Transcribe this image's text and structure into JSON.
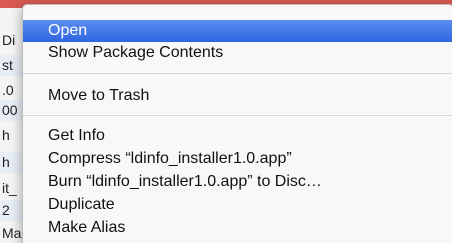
{
  "background_window": {
    "title_bar_color": "#d85a52",
    "rows": [
      "Di",
      "st",
      ".0",
      "00",
      "h",
      "h",
      "it_",
      "2",
      "Ma"
    ]
  },
  "context_menu": {
    "highlight_color": "#3a72e8",
    "items": [
      {
        "label": "Open",
        "highlighted": true
      },
      {
        "label": "Show Package Contents"
      },
      {
        "label": "Move to Trash"
      },
      {
        "label": "Get Info"
      },
      {
        "label": "Compress “ldinfo_installer1.0.app”"
      },
      {
        "label": "Burn “ldinfo_installer1.0.app” to Disc…"
      },
      {
        "label": "Duplicate"
      },
      {
        "label": "Make Alias"
      }
    ]
  }
}
